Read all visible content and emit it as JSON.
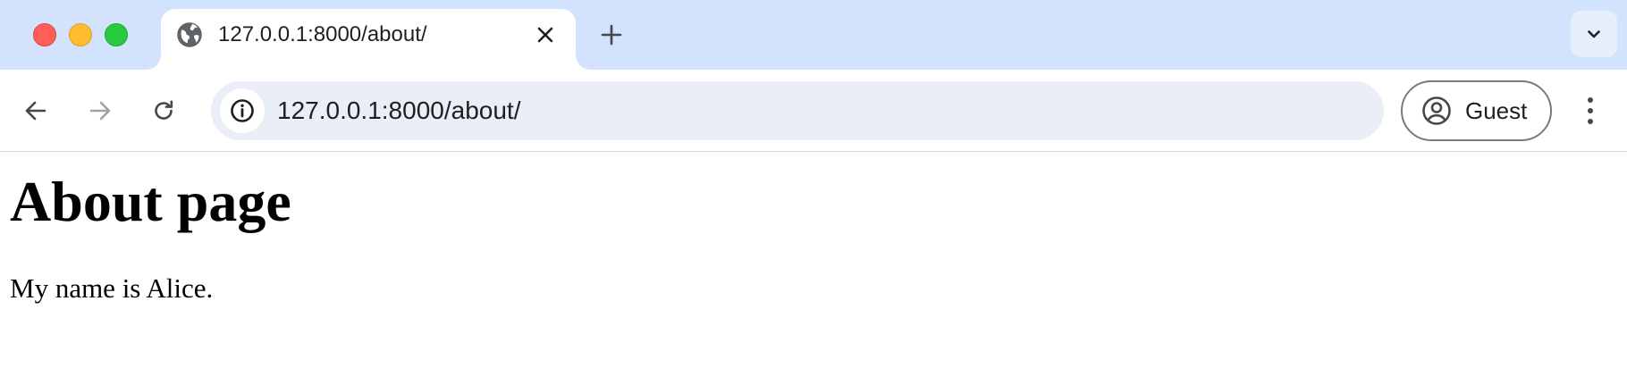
{
  "window": {
    "controls": [
      "close-button",
      "minimize-button",
      "maximize-button"
    ]
  },
  "tab": {
    "title": "127.0.0.1:8000/about/",
    "favicon": "globe-icon",
    "close_icon": "close-icon"
  },
  "tabstrip": {
    "new_tab_icon": "plus-icon",
    "tab_search_icon": "chevron-down-icon"
  },
  "toolbar": {
    "back_icon": "arrow-left-icon",
    "forward_icon": "arrow-right-icon",
    "reload_icon": "reload-icon",
    "site_info_icon": "info-icon",
    "url": "127.0.0.1:8000/about/",
    "profile": {
      "icon": "account-circle-icon",
      "label": "Guest"
    },
    "menu_icon": "kebab-menu-icon"
  },
  "page": {
    "heading": "About page",
    "paragraph": "My name is Alice."
  },
  "colors": {
    "tabstrip_bg": "#d3e3fd",
    "omnibox_bg": "#e9eef7",
    "close_red": "#ff5f57",
    "minimize_yellow": "#febc2e",
    "maximize_green": "#28c840"
  }
}
